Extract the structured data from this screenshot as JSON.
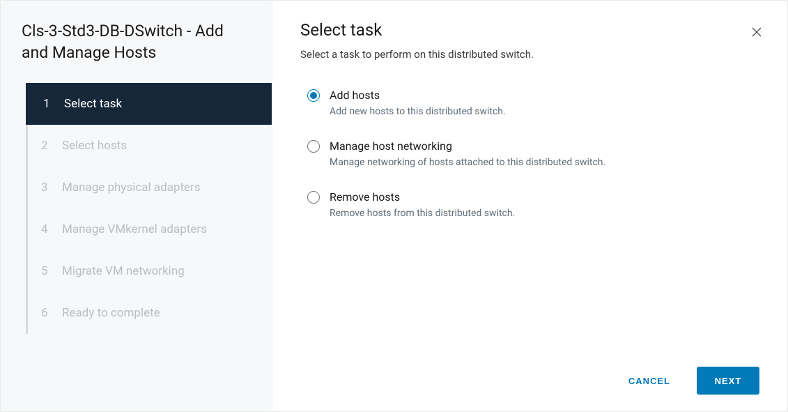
{
  "sidebar": {
    "title": "Cls-3-Std3-DB-DSwitch - Add and Manage Hosts",
    "steps": [
      {
        "num": "1",
        "label": "Select task",
        "state": "active"
      },
      {
        "num": "2",
        "label": "Select hosts",
        "state": "disabled"
      },
      {
        "num": "3",
        "label": "Manage physical adapters",
        "state": "disabled"
      },
      {
        "num": "4",
        "label": "Manage VMkernel adapters",
        "state": "disabled"
      },
      {
        "num": "5",
        "label": "Migrate VM networking",
        "state": "disabled"
      },
      {
        "num": "6",
        "label": "Ready to complete",
        "state": "disabled"
      }
    ]
  },
  "main": {
    "title": "Select task",
    "subtitle": "Select a task to perform on this distributed switch.",
    "options": [
      {
        "label": "Add hosts",
        "desc": "Add new hosts to this distributed switch.",
        "selected": true
      },
      {
        "label": "Manage host networking",
        "desc": "Manage networking of hosts attached to this distributed switch.",
        "selected": false
      },
      {
        "label": "Remove hosts",
        "desc": "Remove hosts from this distributed switch.",
        "selected": false
      }
    ]
  },
  "footer": {
    "cancel": "CANCEL",
    "next": "NEXT"
  }
}
